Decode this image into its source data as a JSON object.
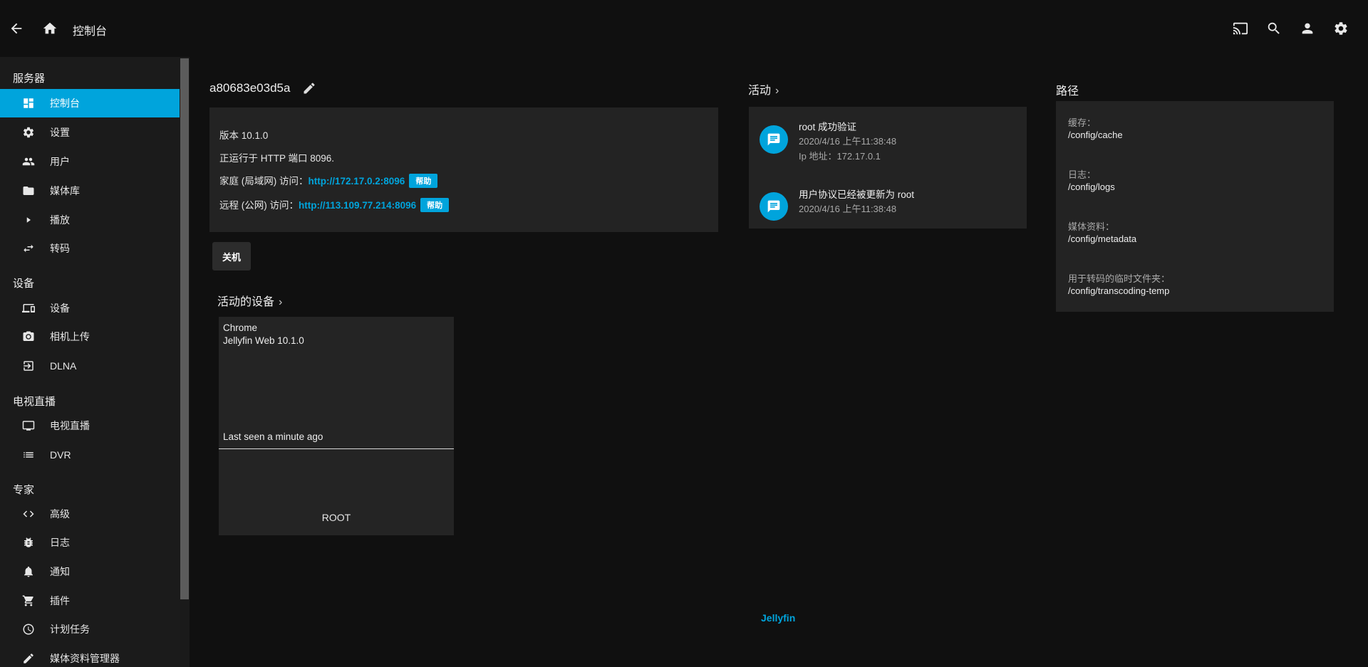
{
  "header": {
    "title": "控制台",
    "icons": [
      "back-arrow-icon",
      "home-icon",
      "cast-icon",
      "search-icon",
      "user-icon",
      "gear-icon"
    ]
  },
  "sidebar": {
    "sections": [
      {
        "title": "服务器",
        "items": [
          {
            "label": "控制台",
            "icon": "dashboard-icon",
            "active": true
          },
          {
            "label": "设置",
            "icon": "gear-icon"
          },
          {
            "label": "用户",
            "icon": "people-icon"
          },
          {
            "label": "媒体库",
            "icon": "folder-icon"
          },
          {
            "label": "播放",
            "icon": "play-icon"
          },
          {
            "label": "转码",
            "icon": "transcode-icon"
          }
        ]
      },
      {
        "title": "设备",
        "items": [
          {
            "label": "设备",
            "icon": "devices-icon"
          },
          {
            "label": "相机上传",
            "icon": "camera-icon"
          },
          {
            "label": "DLNA",
            "icon": "dlna-icon"
          }
        ]
      },
      {
        "title": "电视直播",
        "items": [
          {
            "label": "电视直播",
            "icon": "tv-icon"
          },
          {
            "label": "DVR",
            "icon": "list-icon"
          }
        ]
      },
      {
        "title": "专家",
        "items": [
          {
            "label": "高级",
            "icon": "code-icon"
          },
          {
            "label": "日志",
            "icon": "bug-icon"
          },
          {
            "label": "通知",
            "icon": "bell-icon"
          },
          {
            "label": "插件",
            "icon": "cart-icon"
          },
          {
            "label": "计划任务",
            "icon": "clock-icon"
          },
          {
            "label": "媒体资料管理器",
            "icon": "pencil-icon"
          }
        ]
      }
    ]
  },
  "server": {
    "name": "a80683e03d5a",
    "version_line": "版本 10.1.0",
    "running_line": "正运行于 HTTP 端口 8096.",
    "local_label": "家庭 (局域网) 访问：",
    "local_url": "http://172.17.0.2:8096",
    "remote_label": "远程 (公网) 访问：",
    "remote_url": "http://113.109.77.214:8096",
    "help_label": "帮助",
    "shutdown_label": "关机"
  },
  "active_devices": {
    "title": "活动的设备",
    "device": {
      "client": "Chrome",
      "app": "Jellyfin Web 10.1.0",
      "last_seen": "Last seen a minute ago",
      "user": "ROOT"
    }
  },
  "activity": {
    "title": "活动",
    "items": [
      {
        "title": "root 成功验证",
        "time": "2020/4/16 上午11:38:48",
        "detail": "Ip 地址：172.17.0.1"
      },
      {
        "title": "用户协议已经被更新为 root",
        "time": "2020/4/16 上午11:38:48"
      }
    ]
  },
  "paths": {
    "title": "路径",
    "items": [
      {
        "label": "缓存：",
        "value": "/config/cache"
      },
      {
        "label": "日志：",
        "value": "/config/logs"
      },
      {
        "label": "媒体资料：",
        "value": "/config/metadata"
      },
      {
        "label": "用于转码的临时文件夹：",
        "value": "/config/transcoding-temp"
      }
    ]
  },
  "footer": {
    "link": "Jellyfin"
  },
  "colors": {
    "accent": "#00a4dc",
    "background": "#101010",
    "card": "#232323",
    "sidebar": "#1b1b1b"
  }
}
